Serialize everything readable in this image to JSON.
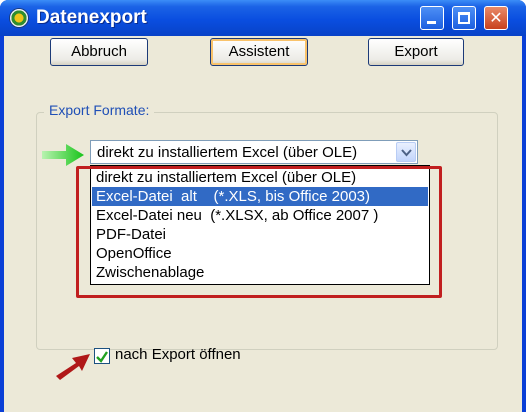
{
  "window": {
    "title": "Datenexport",
    "icon": "app-icon",
    "controls": {
      "minimize": "minimize-icon",
      "maximize": "maximize-icon",
      "close": "close-icon"
    }
  },
  "toolbar": {
    "abbruch_label": "Abbruch",
    "assistent_label": "Assistent",
    "export_label": "Export"
  },
  "export_group": {
    "label": "Export Formate:",
    "selected": "direkt zu installiertem Excel (über OLE)",
    "options": [
      "direkt zu installiertem Excel (über OLE)",
      "Excel-Datei  alt    (*.XLS, bis Office 2003)",
      "Excel-Datei neu  (*.XLSX, ab Office 2007 )",
      "PDF-Datei",
      "OpenOffice",
      "Zwischenablage"
    ],
    "highlighted_option": 1
  },
  "open_after_export": {
    "label": "nach Export öffnen",
    "checked": true
  },
  "colors": {
    "title_bar": "#0a4ee0",
    "dialog_bg": "#ece9d8",
    "selection": "#316ac5",
    "annotation_red": "#c11f1f",
    "annotation_green": "#2fd12f"
  }
}
